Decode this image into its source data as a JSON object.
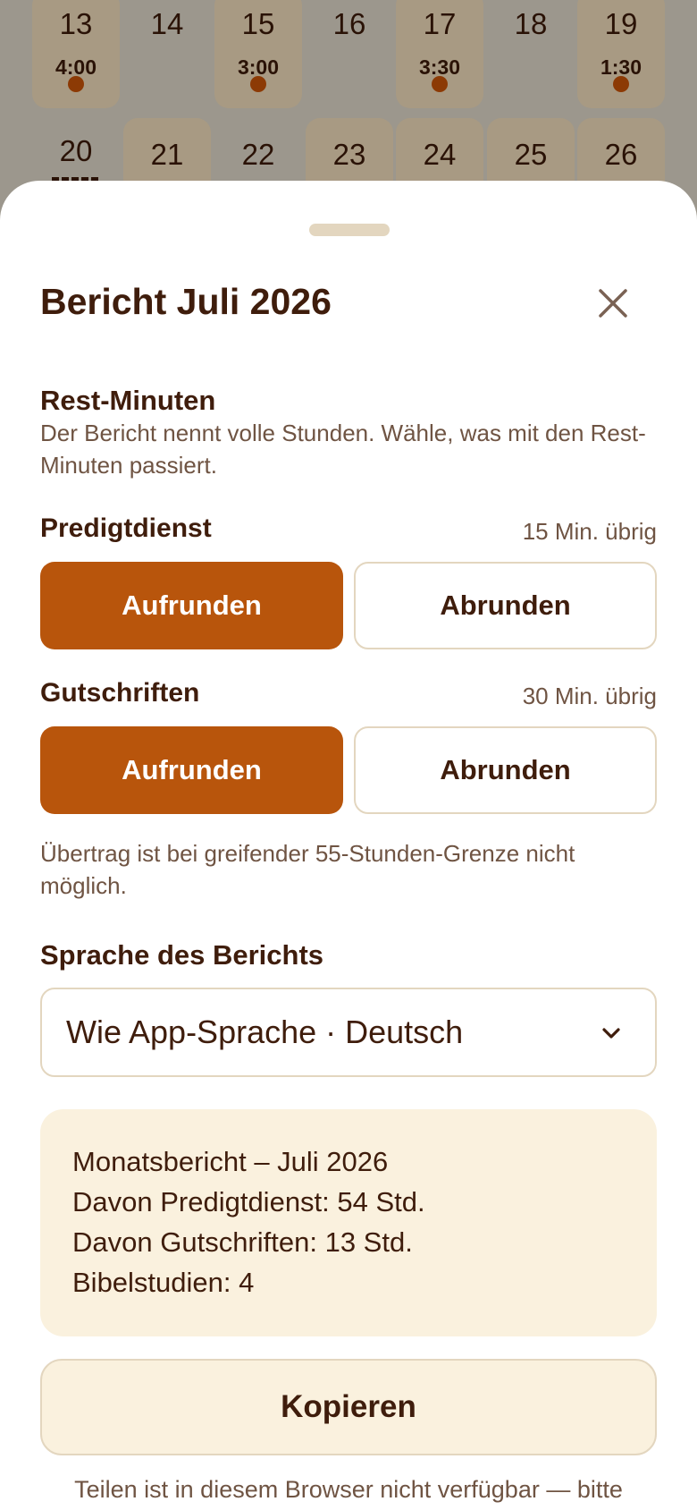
{
  "calendar": {
    "row1": [
      {
        "day": "13",
        "time": "4:00",
        "dot": true,
        "highlight": true
      },
      {
        "day": "14",
        "time": "",
        "dot": false,
        "highlight": false
      },
      {
        "day": "15",
        "time": "3:00",
        "dot": true,
        "highlight": true
      },
      {
        "day": "16",
        "time": "",
        "dot": false,
        "highlight": false
      },
      {
        "day": "17",
        "time": "3:30",
        "dot": true,
        "highlight": true
      },
      {
        "day": "18",
        "time": "",
        "dot": false,
        "highlight": false
      },
      {
        "day": "19",
        "time": "1:30",
        "dot": true,
        "highlight": true
      }
    ],
    "row2": [
      {
        "day": "20",
        "highlight": false,
        "today": true
      },
      {
        "day": "21",
        "highlight": true
      },
      {
        "day": "22",
        "highlight": false
      },
      {
        "day": "23",
        "highlight": true
      },
      {
        "day": "24",
        "highlight": true
      },
      {
        "day": "25",
        "highlight": true
      },
      {
        "day": "26",
        "highlight": true
      }
    ]
  },
  "sheet": {
    "title": "Bericht Juli 2026",
    "close_icon": "close-icon",
    "rest_section": {
      "heading": "Rest-Minuten",
      "description": "Der Bericht nennt volle Stunden. Wähle, was mit den Rest-Minuten passiert."
    },
    "predigtdienst": {
      "label": "Predigtdienst",
      "meta": "15 Min. übrig",
      "round_up": "Aufrunden",
      "round_down": "Abrunden",
      "selected": "up"
    },
    "gutschriften": {
      "label": "Gutschriften",
      "meta": "30 Min. übrig",
      "round_up": "Aufrunden",
      "round_down": "Abrunden",
      "selected": "up"
    },
    "carry_note": "Übertrag ist bei greifender 55-Stunden-Grenze nicht möglich.",
    "language": {
      "heading": "Sprache des Berichts",
      "value": "Wie App-Sprache · Deutsch",
      "icon": "chevron-down-icon"
    },
    "preview": {
      "lines": [
        "Monatsbericht – Juli 2026",
        "Davon Predigtdienst: 54 Std.",
        "Davon Gutschriften: 13 Std.",
        "Bibelstudien: 4"
      ]
    },
    "copy_label": "Kopieren",
    "share_note": "Teilen ist in diesem Browser nicht verfügbar — bitte"
  },
  "colors": {
    "accent": "#b8550c",
    "text": "#3f1d0c",
    "muted": "#6f5443",
    "cream": "#faf1de",
    "border": "#e3d6bf",
    "overlay": "#9c978d"
  }
}
